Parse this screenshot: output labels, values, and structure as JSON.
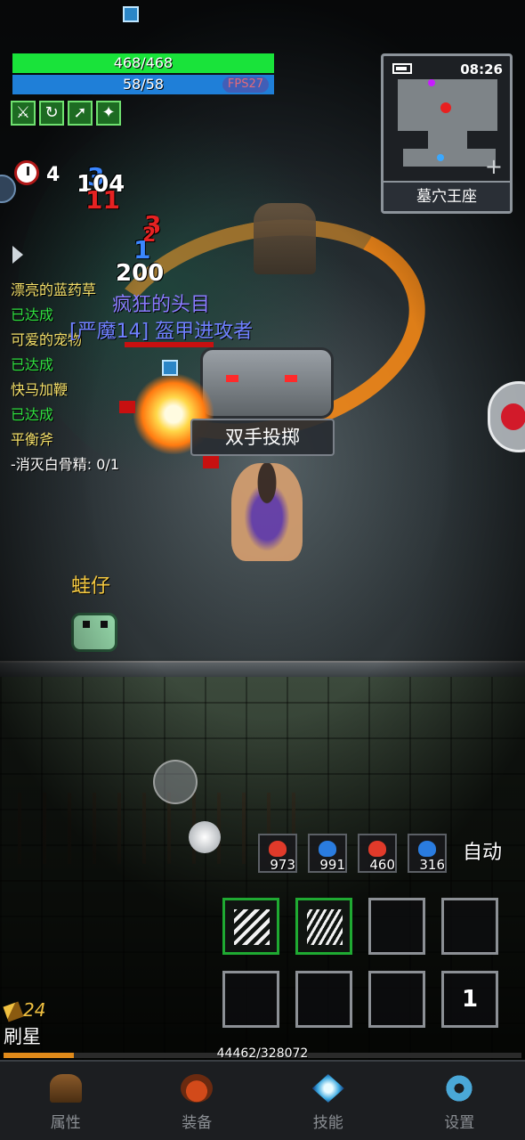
{
  "player": {
    "hp_text": "468/468",
    "mp_text": "58/58",
    "hp_fraction": 1.0,
    "mp_fraction": 1.0,
    "fps": "FPS27",
    "clock_count": "4",
    "name": "刷星",
    "energy": "24"
  },
  "damage_numbers": [
    "3",
    "104",
    "11",
    "3",
    "2",
    "1",
    "200"
  ],
  "quests": [
    {
      "name": "漂亮的蓝药草",
      "status": "已达成"
    },
    {
      "name": "可爱的宠物",
      "status": "已达成"
    },
    {
      "name": "快马加鞭",
      "status": "已达成"
    },
    {
      "name": "平衡斧",
      "status": "-消灭白骨精: 0/1"
    }
  ],
  "enemy": {
    "boss_name": "疯狂的头目",
    "title": "[严魔14] 盔甲进攻者"
  },
  "skill_popup": "双手投掷",
  "pet": {
    "name": "蛙仔"
  },
  "minimap": {
    "time": "08:26",
    "location": "墓穴王座",
    "zoom_label": "+"
  },
  "potions": [
    {
      "count": "973",
      "color": "#e03a2a"
    },
    {
      "count": "991",
      "color": "#2a7ce0"
    },
    {
      "count": "460",
      "color": "#e03a2a"
    },
    {
      "count": "316",
      "color": "#2a7ce0"
    }
  ],
  "auto_label": "自动",
  "skill_slots": [
    {
      "icon": "feather-slash-icon",
      "active": true,
      "label": ""
    },
    {
      "icon": "triple-slash-icon",
      "active": true,
      "label": ""
    },
    {
      "icon": "",
      "active": false,
      "label": ""
    },
    {
      "icon": "",
      "active": false,
      "label": ""
    },
    {
      "icon": "",
      "active": false,
      "label": ""
    },
    {
      "icon": "",
      "active": false,
      "label": ""
    },
    {
      "icon": "",
      "active": false,
      "label": ""
    },
    {
      "icon": "",
      "active": false,
      "label": "1"
    }
  ],
  "xp": {
    "text": "44462/328072",
    "current": 44462,
    "max": 328072
  },
  "nav": [
    {
      "label": "属性",
      "icon": "helmet-icon"
    },
    {
      "label": "装备",
      "icon": "bag-icon"
    },
    {
      "label": "技能",
      "icon": "skill-gem-icon"
    },
    {
      "label": "设置",
      "icon": "gear-icon"
    }
  ]
}
